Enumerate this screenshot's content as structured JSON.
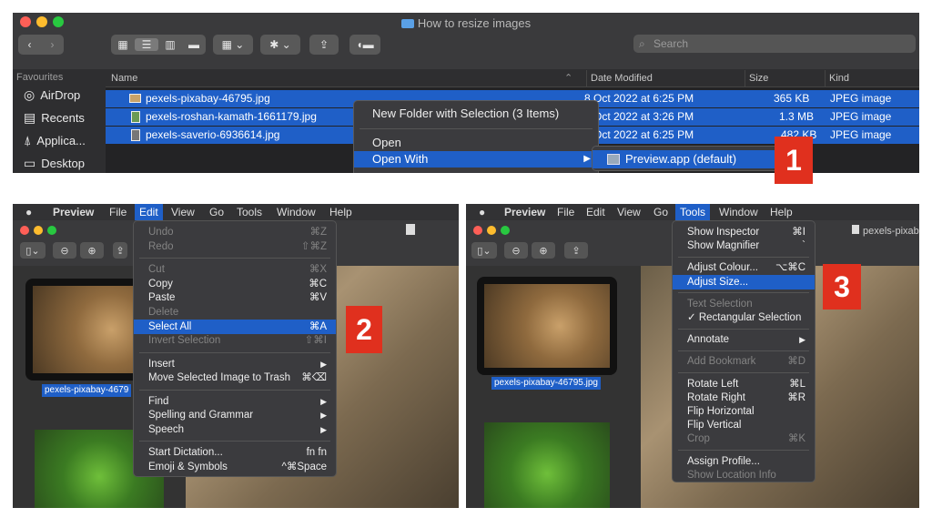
{
  "finder": {
    "title": "How to resize images",
    "search_placeholder": "Search",
    "sidebar": {
      "heading": "Favourites",
      "items": [
        "AirDrop",
        "Recents",
        "Applica...",
        "Desktop"
      ]
    },
    "columns": {
      "name": "Name",
      "date": "Date Modified",
      "size": "Size",
      "kind": "Kind"
    },
    "rows": [
      {
        "name": "pexels-pixabay-46795.jpg",
        "date": "8 Oct 2022 at 6:25 PM",
        "size": "365 KB",
        "kind": "JPEG image"
      },
      {
        "name": "pexels-roshan-kamath-1661179.jpg",
        "date": "Oct 2022 at 3:26 PM",
        "size": "1.3 MB",
        "kind": "JPEG image"
      },
      {
        "name": "pexels-saverio-6936614.jpg",
        "date": "Oct 2022 at 6:25 PM",
        "size": "482 KB",
        "kind": "JPEG image"
      }
    ],
    "context_menu": {
      "new_folder": "New Folder with Selection (3 Items)",
      "open": "Open",
      "open_with": "Open With"
    },
    "submenu": {
      "preview": "Preview.app (default)"
    },
    "step": "1"
  },
  "panel2": {
    "menubar": {
      "apple": "",
      "app": "Preview",
      "file": "File",
      "edit": "Edit",
      "view": "View",
      "go": "Go",
      "tools": "Tools",
      "window": "Window",
      "help": "Help"
    },
    "caption": "pexels-pixabay-4679",
    "step": "2",
    "menu": [
      {
        "label": "Undo",
        "sc": "⌘Z",
        "dis": true
      },
      {
        "label": "Redo",
        "sc": "⇧⌘Z",
        "dis": true
      },
      {
        "sep": true
      },
      {
        "label": "Cut",
        "sc": "⌘X",
        "dis": true
      },
      {
        "label": "Copy",
        "sc": "⌘C"
      },
      {
        "label": "Paste",
        "sc": "⌘V"
      },
      {
        "label": "Delete",
        "sc": "",
        "dis": true
      },
      {
        "label": "Select All",
        "sc": "⌘A",
        "hl": true
      },
      {
        "label": "Invert Selection",
        "sc": "⇧⌘I",
        "dis": true
      },
      {
        "sep": true
      },
      {
        "label": "Insert",
        "sc": "▶"
      },
      {
        "label": "Move Selected Image to Trash",
        "sc": "⌘⌫"
      },
      {
        "sep": true
      },
      {
        "label": "Find",
        "sc": "▶"
      },
      {
        "label": "Spelling and Grammar",
        "sc": "▶"
      },
      {
        "label": "Speech",
        "sc": "▶"
      },
      {
        "sep": true
      },
      {
        "label": "Start Dictation...",
        "sc": "fn fn"
      },
      {
        "label": "Emoji & Symbols",
        "sc": "^⌘Space"
      }
    ]
  },
  "panel3": {
    "menubar": {
      "apple": "",
      "app": "Preview",
      "file": "File",
      "edit": "Edit",
      "view": "View",
      "go": "Go",
      "tools": "Tools",
      "window": "Window",
      "help": "Help"
    },
    "doc_title": "pexels-pixab",
    "caption": "pexels-pixabay-46795.jpg",
    "step": "3",
    "menu": [
      {
        "label": "Show Inspector",
        "sc": "⌘I"
      },
      {
        "label": "Show Magnifier",
        "sc": "`"
      },
      {
        "sep": true
      },
      {
        "label": "Adjust Colour...",
        "sc": "⌥⌘C"
      },
      {
        "label": "Adjust Size...",
        "sc": "",
        "hl": true
      },
      {
        "sep": true
      },
      {
        "label": "Text Selection",
        "sc": "",
        "dis": true
      },
      {
        "label": "✓ Rectangular Selection",
        "sc": ""
      },
      {
        "sep": true
      },
      {
        "label": "Annotate",
        "sc": "▶"
      },
      {
        "sep": true
      },
      {
        "label": "Add Bookmark",
        "sc": "⌘D",
        "dis": true
      },
      {
        "sep": true
      },
      {
        "label": "Rotate Left",
        "sc": "⌘L"
      },
      {
        "label": "Rotate Right",
        "sc": "⌘R"
      },
      {
        "label": "Flip Horizontal",
        "sc": ""
      },
      {
        "label": "Flip Vertical",
        "sc": ""
      },
      {
        "label": "Crop",
        "sc": "⌘K",
        "dis": true
      },
      {
        "sep": true
      },
      {
        "label": "Assign Profile...",
        "sc": ""
      },
      {
        "label": "Show Location Info",
        "sc": "",
        "dis": true
      }
    ]
  },
  "colors": {
    "accent": "#1f5fc7",
    "badge": "#e0301e"
  }
}
